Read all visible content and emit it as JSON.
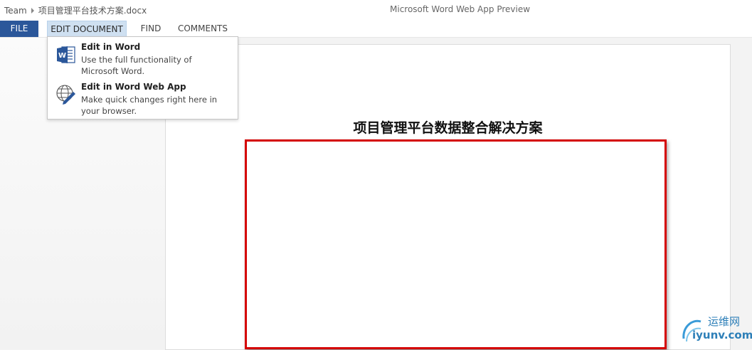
{
  "titlebar": {
    "breadcrumb": [
      "Team",
      "项目管理平台技术方案.docx"
    ],
    "app_title": "Microsoft Word Web App Preview"
  },
  "ribbon": {
    "tabs": [
      {
        "label": "FILE"
      },
      {
        "label": "EDIT DOCUMENT"
      },
      {
        "label": "FIND"
      },
      {
        "label": "COMMENTS"
      }
    ]
  },
  "dropdown": {
    "items": [
      {
        "title": "Edit in Word",
        "description": "Use the full functionality of Microsoft Word.",
        "icon": "word-icon"
      },
      {
        "title": "Edit in Word Web App",
        "description": "Make quick changes right here in your browser.",
        "icon": "globe-pen-icon"
      }
    ]
  },
  "document": {
    "title": "项目管理平台数据整合解决方案"
  },
  "watermark": {
    "text_cn": "运维网",
    "text_en": "iyunv.com"
  },
  "colors": {
    "file_tab": "#2b579a",
    "edit_tab_active": "#cfe0f1",
    "image_border": "#d40000",
    "watermark": "#2d7fb8"
  }
}
